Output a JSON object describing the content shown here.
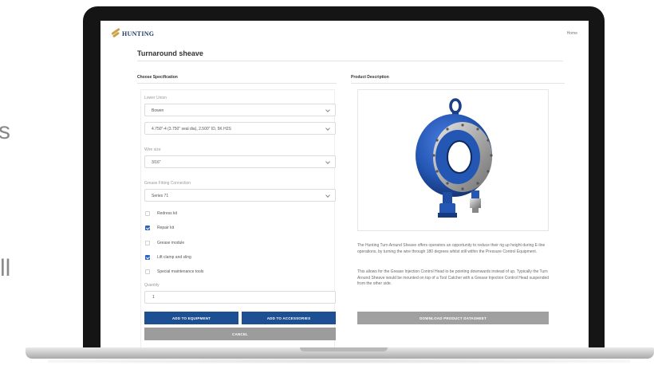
{
  "left_fragments": {
    "top": "s",
    "bottom": "ll"
  },
  "header": {
    "logo_text": "HUNTING",
    "home_link": "Home"
  },
  "page": {
    "title": "Turnaround sheave"
  },
  "sections": {
    "left_heading": "Choose Specification",
    "right_heading": "Product Description"
  },
  "spec": {
    "lower_union_label": "Lower Union",
    "lower_union_value": "Bowen",
    "union_size_value": "4.750\"-4 (3.750\" seal dia), 2.500\" ID, 5K H2S",
    "wire_size_label": "Wire size",
    "wire_size_value": "3/16\"",
    "grease_label": "Grease Fitting Connection",
    "grease_value": "Series 71",
    "options": [
      {
        "label": "Redress kit",
        "checked": false
      },
      {
        "label": "Repair kit",
        "checked": true
      },
      {
        "label": "Grease module",
        "checked": false
      },
      {
        "label": "Lift clamp and sling",
        "checked": true
      },
      {
        "label": "Special maintenance tools",
        "checked": false
      }
    ],
    "quantity_label": "Quantity",
    "quantity_value": "1"
  },
  "buttons": {
    "add_to_equipment": "ADD TO EQUIPMENT",
    "add_to_accessories": "ADD TO ACCESSORIES",
    "cancel": "CANCEL",
    "download_datasheet": "DOWNLOAD PRODUCT DATASHEET"
  },
  "description": {
    "para1": "The Hunting Turn Around Sheave offers operators an opportunity to reduce their rig up height during E-line operations, by turning the wire through 180 degrees whilst still within the Pressure Control Equipment.",
    "para2": "This allows for the Grease Injection Control Head to be pointing downwards instead of up. Typically the Turn Around Sheave would be mounted on top of a Tool Catcher with a Grease Injection Control Head suspended from the other side."
  },
  "colors": {
    "primary_button": "#1d4f93",
    "secondary_button": "#9c9c9c",
    "checkbox_on": "#2e63b9",
    "product_blue": "#2456b3"
  },
  "icons": {
    "logo": "hunting-logo-icon",
    "select_arrow": "chevron-down-icon",
    "product": "turnaround-sheave-product-image"
  }
}
